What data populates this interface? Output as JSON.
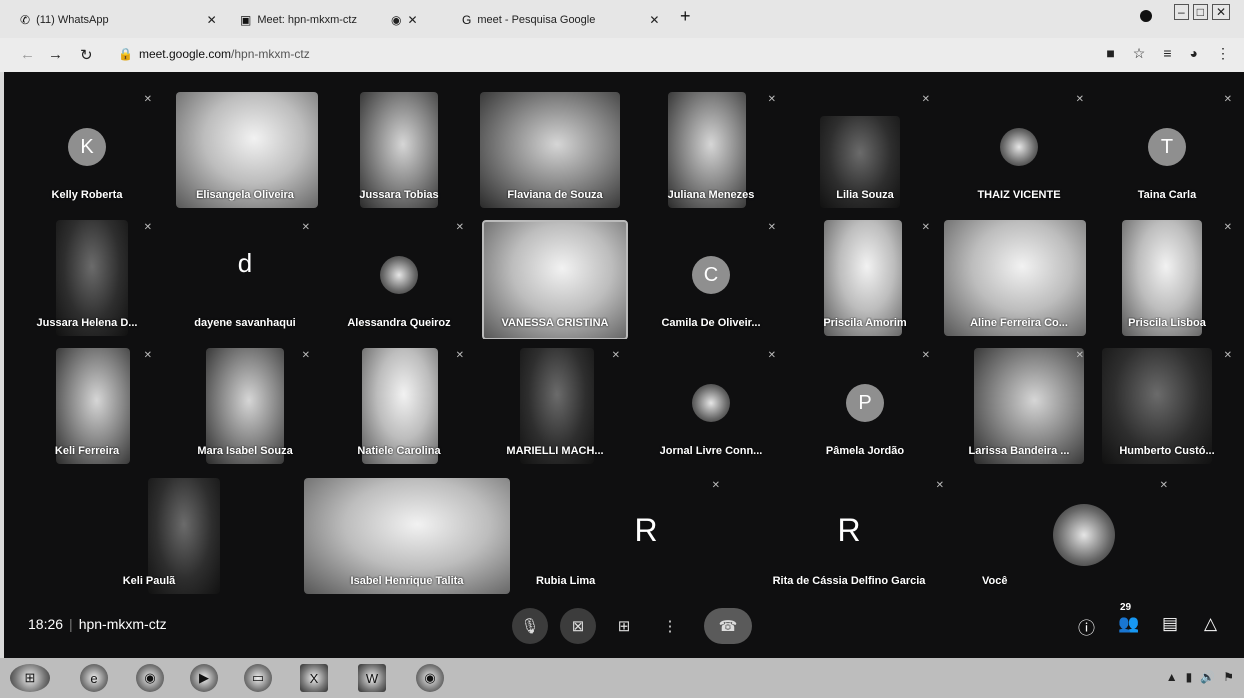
{
  "browser": {
    "tabs": [
      {
        "label": "(11) WhatsApp",
        "icon": "whatsapp-icon"
      },
      {
        "label": "Meet: hpn-mkxm-ctz",
        "icon": "meet-icon",
        "recording": true
      },
      {
        "label": "meet - Pesquisa Google",
        "icon": "google-icon",
        "prefix": "G"
      }
    ],
    "new_tab": "+",
    "url_host": "meet.google.com",
    "url_path": "/hpn-mkxm-ctz"
  },
  "participants_row1": [
    {
      "name": "Kelly Roberta",
      "avatar": "K"
    },
    {
      "name": "Elisangela Oliveira",
      "photo": true
    },
    {
      "name": "Jussara Tobias",
      "photo": true
    },
    {
      "name": "Flaviana de Souza",
      "photo": true
    },
    {
      "name": "Juliana Menezes",
      "photo": true
    },
    {
      "name": "Lilia Souza",
      "photo": true
    },
    {
      "name": "THAIZ VICENTE",
      "avatar_photo": true
    },
    {
      "name": "Taina Carla",
      "avatar": "T"
    }
  ],
  "participants_row2": [
    {
      "name": "Jussara Helena D...",
      "photo": true
    },
    {
      "name": "dayene savanhaqui",
      "letter": "d"
    },
    {
      "name": "Alessandra Queiroz",
      "photo": true
    },
    {
      "name": "VANESSA CRISTINA",
      "photo": true
    },
    {
      "name": "Camila De Oliveir...",
      "avatar": "C"
    },
    {
      "name": "Priscila Amorim",
      "photo": true
    },
    {
      "name": "Aline Ferreira Co...",
      "photo": true
    },
    {
      "name": "Priscila Lisboa",
      "photo": true
    }
  ],
  "participants_row3": [
    {
      "name": "Keli Ferreira",
      "photo": true
    },
    {
      "name": "Mara Isabel Souza",
      "photo": true
    },
    {
      "name": "Natiele Carolina",
      "photo": true
    },
    {
      "name": "MARIELLI MACH...",
      "photo": true
    },
    {
      "name": "Jornal Livre Conn...",
      "avatar_photo": true
    },
    {
      "name": "Pâmela Jordão",
      "avatar": "P"
    },
    {
      "name": "Larissa Bandeira ...",
      "photo": true
    },
    {
      "name": "Humberto Custó...",
      "photo": true
    }
  ],
  "participants_row4": [
    {
      "name": "Keli Paulã",
      "photo": true
    },
    {
      "name": "Isabel Henrique Talita",
      "photo": true
    },
    {
      "name": "Rubia Lima",
      "letter": "R"
    },
    {
      "name": "Rita de Cássia Delfino Garcia",
      "letter": "R"
    },
    {
      "name": "Você",
      "avatar_photo": true
    }
  ],
  "meeting": {
    "time": "18:26",
    "code": "hpn-mkxm-ctz",
    "participant_count": "29"
  }
}
